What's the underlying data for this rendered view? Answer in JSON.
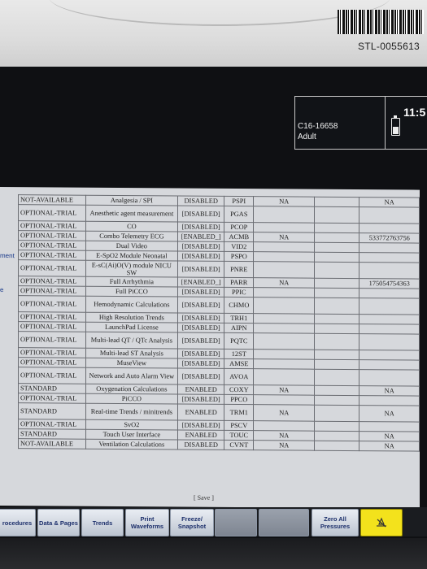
{
  "device": {
    "asset_tag": "STL-0055613"
  },
  "header": {
    "patient_id": "C16-16658",
    "patient_type": "Adult",
    "clock": "11:5"
  },
  "left_labels": [
    "ment",
    "e"
  ],
  "table": {
    "partial_top": "······",
    "rows": [
      {
        "status": "NOT-AVAILABLE",
        "option": "Analgesia / SPI",
        "key": "DISABLED",
        "code": "PSPI",
        "c5": "NA",
        "c6": "",
        "c7": "NA"
      },
      {
        "status": "OPTIONAL-TRIAL",
        "option": "Anesthetic agent measurement",
        "key": "[DISABLED]",
        "code": "PGAS",
        "c5": "",
        "c6": "",
        "c7": ""
      },
      {
        "status": "OPTIONAL-TRIAL",
        "option": "CO",
        "key": "[DISABLED]",
        "code": "PCOP",
        "c5": "",
        "c6": "",
        "c7": ""
      },
      {
        "status": "OPTIONAL-TRIAL",
        "option": "Combo Telemetry ECG",
        "key": "[ENABLED_]",
        "code": "ACMB",
        "c5": "NA",
        "c6": "",
        "c7": "533772763756"
      },
      {
        "status": "OPTIONAL-TRIAL",
        "option": "Dual Video",
        "key": "[DISABLED]",
        "code": "VID2",
        "c5": "",
        "c6": "",
        "c7": ""
      },
      {
        "status": "OPTIONAL-TRIAL",
        "option": "E-SpO2 Module Neonatal",
        "key": "[DISABLED]",
        "code": "PSPO",
        "c5": "",
        "c6": "",
        "c7": ""
      },
      {
        "status": "OPTIONAL-TRIAL",
        "option": "E-sC(Ai)O(V) module NICU SW",
        "key": "[DISABLED]",
        "code": "PNRE",
        "c5": "",
        "c6": "",
        "c7": ""
      },
      {
        "status": "OPTIONAL-TRIAL",
        "option": "Full Arrhythmia",
        "key": "[ENABLED_]",
        "code": "PARR",
        "c5": "NA",
        "c6": "",
        "c7": "175054754363"
      },
      {
        "status": "OPTIONAL-TRIAL",
        "option": "Full PiCCO",
        "key": "[DISABLED]",
        "code": "PPIC",
        "c5": "",
        "c6": "",
        "c7": ""
      },
      {
        "status": "OPTIONAL-TRIAL",
        "option": "Hemodynamic Calculations",
        "key": "[DISABLED]",
        "code": "CHMO",
        "c5": "",
        "c6": "",
        "c7": ""
      },
      {
        "status": "OPTIONAL-TRIAL",
        "option": "High Resolution Trends",
        "key": "[DISABLED]",
        "code": "TRH1",
        "c5": "",
        "c6": "",
        "c7": ""
      },
      {
        "status": "OPTIONAL-TRIAL",
        "option": "LaunchPad License",
        "key": "[DISABLED]",
        "code": "AIPN",
        "c5": "",
        "c6": "",
        "c7": ""
      },
      {
        "status": "OPTIONAL-TRIAL",
        "option": "Multi-lead QT / QTc Analysis",
        "key": "[DISABLED]",
        "code": "PQTC",
        "c5": "",
        "c6": "",
        "c7": ""
      },
      {
        "status": "OPTIONAL-TRIAL",
        "option": "Multi-lead ST Analysis",
        "key": "[DISABLED]",
        "code": "12ST",
        "c5": "",
        "c6": "",
        "c7": ""
      },
      {
        "status": "OPTIONAL-TRIAL",
        "option": "MuseView",
        "key": "[DISABLED]",
        "code": "AMSE",
        "c5": "",
        "c6": "",
        "c7": ""
      },
      {
        "status": "OPTIONAL-TRIAL",
        "option": "Network and Auto Alarm View",
        "key": "[DISABLED]",
        "code": "AVOA",
        "c5": "",
        "c6": "",
        "c7": ""
      },
      {
        "status": "STANDARD",
        "option": "Oxygenation Calculations",
        "key": "ENABLED",
        "code": "COXY",
        "c5": "NA",
        "c6": "",
        "c7": "NA"
      },
      {
        "status": "OPTIONAL-TRIAL",
        "option": "PiCCO",
        "key": "[DISABLED]",
        "code": "PPCO",
        "c5": "",
        "c6": "",
        "c7": ""
      },
      {
        "status": "STANDARD",
        "option": "Real-time Trends / minitrends",
        "key": "ENABLED",
        "code": "TRM1",
        "c5": "NA",
        "c6": "",
        "c7": "NA"
      },
      {
        "status": "OPTIONAL-TRIAL",
        "option": "SvO2",
        "key": "[DISABLED]",
        "code": "PSCV",
        "c5": "",
        "c6": "",
        "c7": ""
      },
      {
        "status": "STANDARD",
        "option": "Touch User Interface",
        "key": "ENABLED",
        "code": "TOUC",
        "c5": "NA",
        "c6": "",
        "c7": "NA"
      },
      {
        "status": "NOT-AVAILABLE",
        "option": "Ventilation Calculations",
        "key": "DISABLED",
        "code": "CVNT",
        "c5": "NA",
        "c6": "",
        "c7": "NA"
      }
    ],
    "save_label": "[ Save ]"
  },
  "buttons": [
    {
      "label": "rocedures",
      "dim": false
    },
    {
      "label": "Data & Pages",
      "dim": false
    },
    {
      "label": "Trends",
      "dim": false
    },
    {
      "label": "Print Waveforms",
      "dim": false
    },
    {
      "label": "Freeze/ Snapshot",
      "dim": false
    },
    {
      "label": "",
      "dim": true
    },
    {
      "label": "",
      "dim": true
    },
    {
      "label": "Zero All Pressures",
      "dim": false
    }
  ],
  "alarm_icon": "alarm-silence-icon"
}
